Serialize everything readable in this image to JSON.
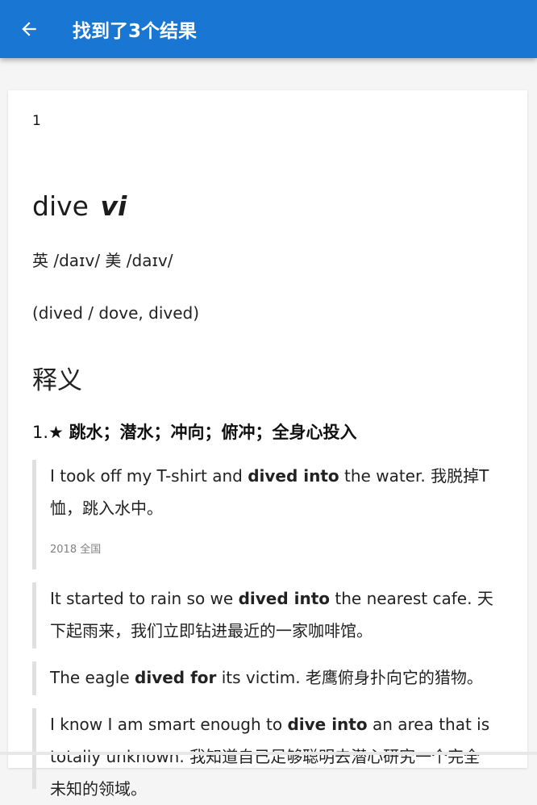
{
  "appbar": {
    "back_icon": "arrow-left-icon",
    "title": "找到了3个结果",
    "color": "#1976d2"
  },
  "result": {
    "index": "1",
    "word": "dive",
    "pos": "vi",
    "phonetics": "英 /daɪv/ 美 /daɪv/",
    "forms": "(dived / dove, dived)",
    "section_title": "释义",
    "sense": {
      "number": "1.★",
      "definition": "跳水；潜水；冲向；俯冲；全身心投入"
    },
    "examples": [
      {
        "before": "I took off my T-shirt and ",
        "bold": "dived into",
        "after": " the water. 我脱掉T恤，跳入水中。",
        "source": "2018 全国"
      },
      {
        "before": "It started to rain so we ",
        "bold": "dived into",
        "after": " the nearest cafe. 天下起雨来，我们立即钻进最近的一家咖啡馆。"
      },
      {
        "before": "The eagle ",
        "bold": "dived for",
        "after": " its victim. 老鹰俯身扑向它的猎物。"
      },
      {
        "before": "I know I am smart enough to ",
        "bold": "dive into",
        "after": " an area that is totally unknown. 我知道自己足够聪明去潜心研究一个完全未知的领域。"
      }
    ]
  }
}
